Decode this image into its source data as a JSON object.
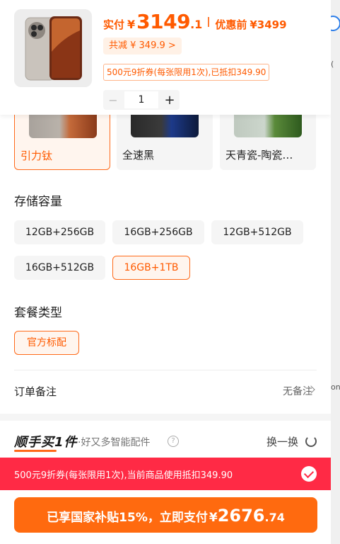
{
  "header": {
    "price_label": "实付",
    "currency": "¥",
    "price_int": "3149",
    "price_dec": ".1",
    "orig_label": "优惠前",
    "orig_price": "¥3499",
    "reduce_text": "共减 ¥ 349.9 >",
    "coupon_text": "500元9折券(每张限用1次),已抵扣349.90",
    "qty_minus": "−",
    "qty": "1",
    "qty_plus": "+"
  },
  "colors": {
    "items": [
      {
        "label": "引力钛",
        "selected": true
      },
      {
        "label": "全速黑",
        "selected": false
      },
      {
        "label": "天青瓷-陶瓷…",
        "selected": false
      }
    ]
  },
  "storage": {
    "title": "存储容量",
    "options": [
      {
        "label": "12GB+256GB",
        "selected": false
      },
      {
        "label": "16GB+256GB",
        "selected": false
      },
      {
        "label": "12GB+512GB",
        "selected": false
      },
      {
        "label": "16GB+512GB",
        "selected": false
      },
      {
        "label": "16GB+1TB",
        "selected": true
      }
    ]
  },
  "package": {
    "title": "套餐类型",
    "options": [
      {
        "label": "官方标配",
        "selected": true
      }
    ]
  },
  "remark": {
    "label": "订单备注",
    "value": "无备注"
  },
  "addon": {
    "title": "顺手买1件",
    "subtitle": "·好又多智能配件",
    "help": "?",
    "swap": "换一换"
  },
  "coupon_bar": {
    "text": "500元9折券(每张限用1次),当前商品使用抵扣349.90"
  },
  "pay": {
    "prefix": "已享国家补贴15%，立即支付",
    "currency": "¥",
    "int": "2676",
    "dec": ".74"
  },
  "background": {
    "marks": [
      "(",
      "on"
    ]
  },
  "colors_theme": {
    "accent": "#ff5a00",
    "coupon_red": "#ff2a45",
    "bg_link": "#2b7de9"
  }
}
